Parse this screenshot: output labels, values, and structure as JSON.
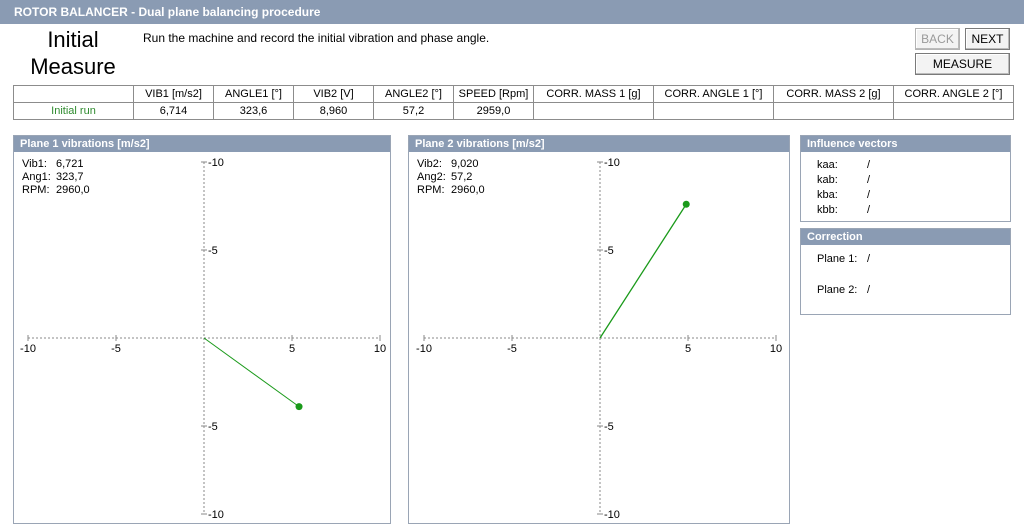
{
  "window": {
    "title": "ROTOR BALANCER - Dual plane balancing procedure"
  },
  "step": {
    "title_line1": "Initial",
    "title_line2": "Measure",
    "instructions": "Run the machine and record the initial vibration and phase angle."
  },
  "buttons": {
    "back": "BACK",
    "next": "NEXT",
    "measure": "MEASURE"
  },
  "table": {
    "headers": [
      "",
      "VIB1 [m/s2]",
      "ANGLE1 [°]",
      "VIB2 [V]",
      "ANGLE2 [°]",
      "SPEED [Rpm]",
      "CORR. MASS 1 [g]",
      "CORR. ANGLE 1 [°]",
      "CORR. MASS 2 [g]",
      "CORR. ANGLE 2 [°]"
    ],
    "row": {
      "label": "Initial run",
      "vib1": "6,714",
      "angle1": "323,6",
      "vib2": "8,960",
      "angle2": "57,2",
      "speed": "2959,0"
    }
  },
  "plot1": {
    "title": "Plane 1 vibrations [m/s2]",
    "readout": {
      "vib_label": "Vib1:",
      "vib_value": "6,721",
      "ang_label": "Ang1:",
      "ang_value": "323,7",
      "rpm_label": "RPM:",
      "rpm_value": "2960,0"
    },
    "ticks": {
      "x": [
        "-10",
        "-5",
        "5",
        "10"
      ],
      "y_top": "-10",
      "y_upper": "-5",
      "y_lower": "-5",
      "y_bottom": "-10"
    },
    "vector": {
      "x": 5.4,
      "y": -3.9
    },
    "color": "#1a9a1a"
  },
  "plot2": {
    "title": "Plane 2 vibrations [m/s2]",
    "readout": {
      "vib_label": "Vib2:",
      "vib_value": "9,020",
      "ang_label": "Ang2:",
      "ang_value": "57,2",
      "rpm_label": "RPM:",
      "rpm_value": "2960,0"
    },
    "ticks": {
      "x": [
        "-10",
        "-5",
        "5",
        "10"
      ],
      "y_top": "-10",
      "y_upper": "-5",
      "y_lower": "-5",
      "y_bottom": "-10"
    },
    "vector": {
      "x": 4.9,
      "y": 7.6
    },
    "color": "#1a9a1a"
  },
  "influence": {
    "title": "Influence vectors",
    "items": [
      {
        "label": "kaa:",
        "value": "/"
      },
      {
        "label": "kab:",
        "value": "/"
      },
      {
        "label": "kba:",
        "value": "/"
      },
      {
        "label": "kbb:",
        "value": "/"
      }
    ]
  },
  "correction": {
    "title": "Correction",
    "plane1_label": "Plane 1:",
    "plane1_value": "/",
    "plane2_label": "Plane 2:",
    "plane2_value": "/"
  }
}
